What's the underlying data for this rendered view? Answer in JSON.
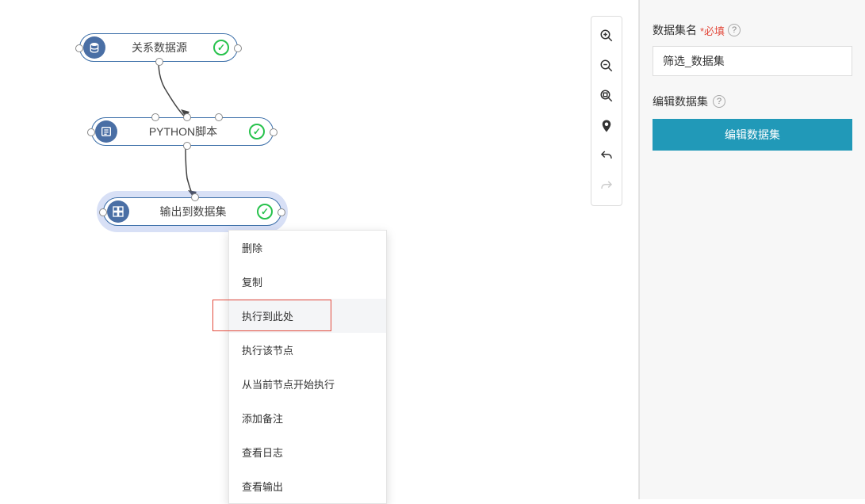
{
  "nodes": {
    "n1": {
      "label": "关系数据源"
    },
    "n2": {
      "label": "PYTHON脚本"
    },
    "n3": {
      "label": "输出到数据集"
    }
  },
  "contextMenu": {
    "items": [
      "删除",
      "复制",
      "执行到此处",
      "执行该节点",
      "从当前节点开始执行",
      "添加备注",
      "查看日志",
      "查看输出"
    ]
  },
  "sidebar": {
    "nameLabel": "数据集名",
    "required": "*必填",
    "nameValue": "筛选_数据集",
    "editLabel": "编辑数据集",
    "editButton": "编辑数据集"
  }
}
